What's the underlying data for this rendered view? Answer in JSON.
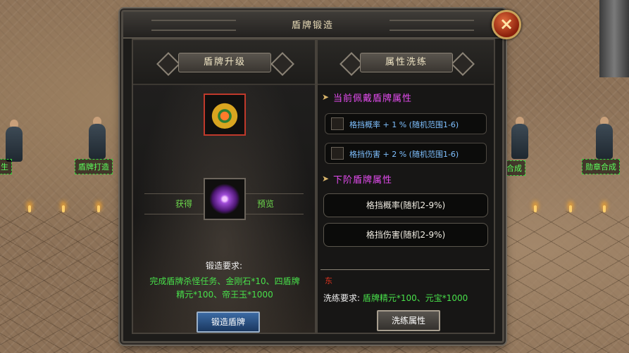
{
  "window": {
    "title": "盾牌锻造",
    "close": "×"
  },
  "left": {
    "header": "盾牌升级",
    "tabs": {
      "obtain": "获得",
      "preview": "预览"
    },
    "requirement_title": "锻造要求:",
    "requirement_lines": [
      "完成盾牌杀怪任务、金刚石*10、四盾牌",
      "精元*100、帝王玉*1000"
    ],
    "forge_button": "锻造盾牌"
  },
  "right": {
    "header": "属性洗练",
    "current_title": "当前佩戴盾牌属性",
    "current_attrs": [
      "格挡概率 + 1 %  (随机范围1-6)",
      "格挡伤害 + 2 %  (随机范围1-6)"
    ],
    "next_title": "下阶盾牌属性",
    "next_attrs": [
      "格挡概率(随机2-9%)",
      "格挡伤害(随机2-9%)"
    ],
    "red_mark": "东",
    "wash_label": "洗练要求:",
    "wash_value": "盾牌精元*100、元宝*1000",
    "wash_button": "洗练属性"
  },
  "scene": {
    "npc_labels": [
      "盾牌打造",
      "勋章合成",
      "生",
      "合成"
    ]
  },
  "icons": {
    "current_item": "golden-shield-icon",
    "next_item": "purple-shield-icon"
  }
}
